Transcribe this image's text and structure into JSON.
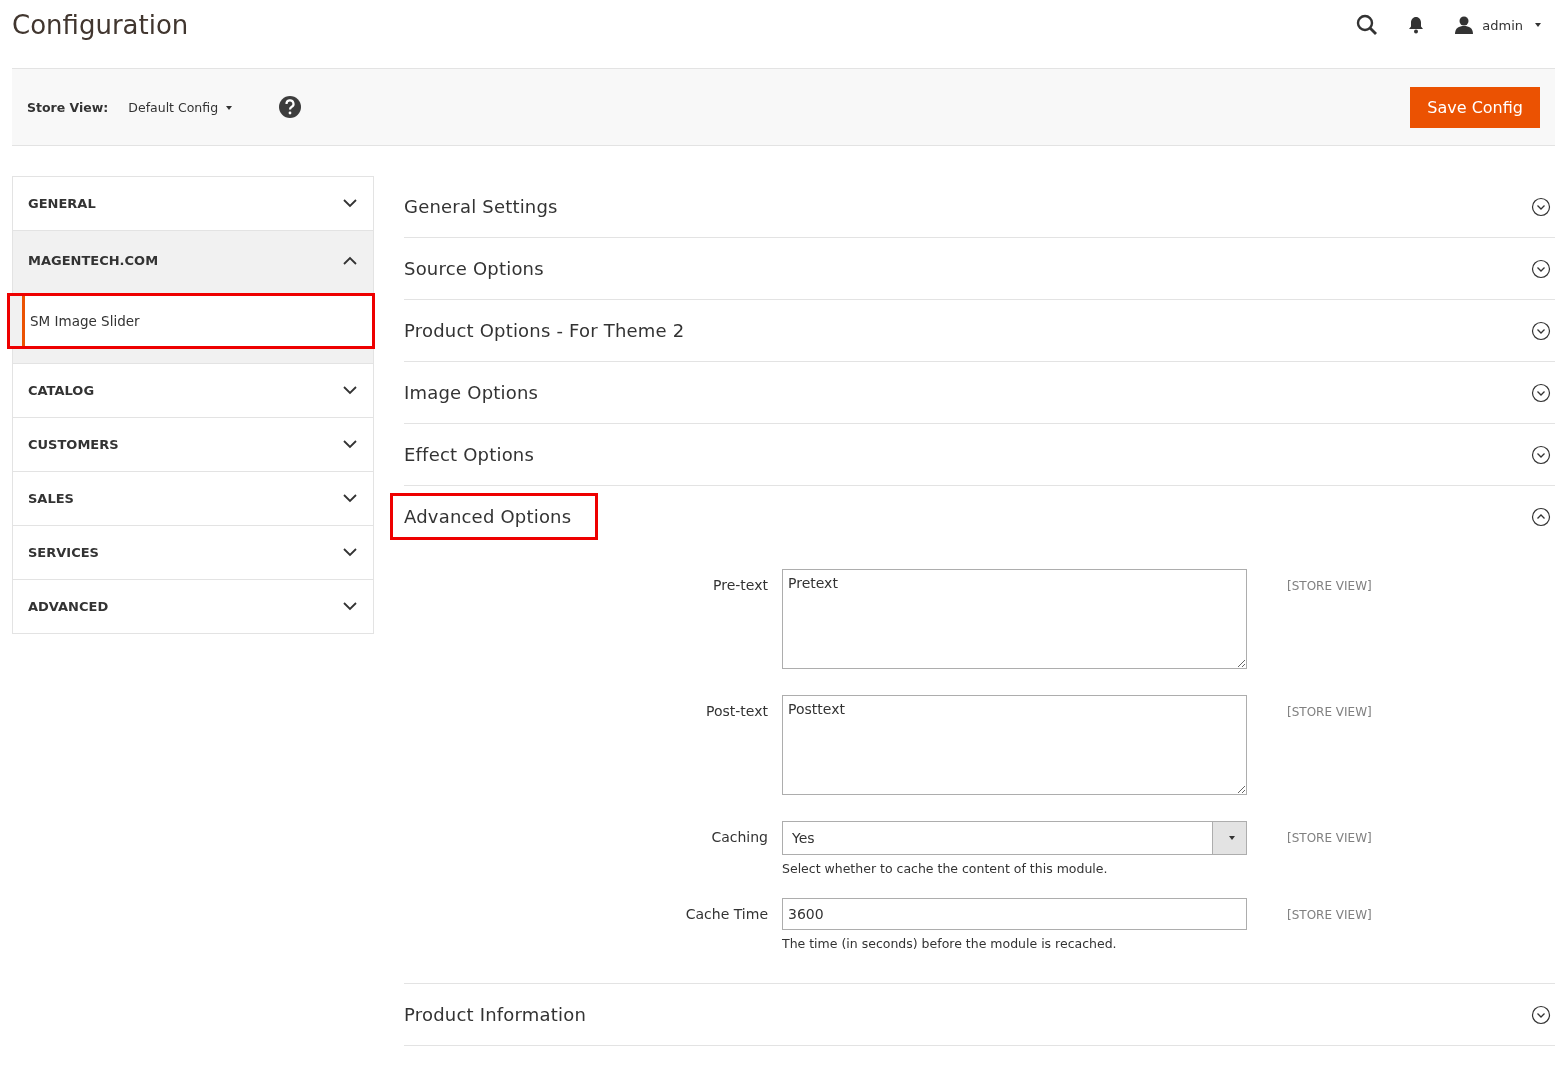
{
  "page_title": "Configuration",
  "header": {
    "user": "admin"
  },
  "store_view": {
    "label": "Store View:",
    "value": "Default Config"
  },
  "save_button": "Save Config",
  "sidebar": [
    {
      "label": "GENERAL",
      "expanded": false
    },
    {
      "label": "MAGENTECH.COM",
      "expanded": true,
      "children": [
        {
          "label": "SM Image Slider",
          "selected": true,
          "highlighted": true
        }
      ]
    },
    {
      "label": "CATALOG",
      "expanded": false
    },
    {
      "label": "CUSTOMERS",
      "expanded": false
    },
    {
      "label": "SALES",
      "expanded": false
    },
    {
      "label": "SERVICES",
      "expanded": false
    },
    {
      "label": "ADVANCED",
      "expanded": false
    }
  ],
  "sections": [
    {
      "title": "General Settings",
      "expanded": false,
      "highlighted": false
    },
    {
      "title": "Source Options",
      "expanded": false,
      "highlighted": false
    },
    {
      "title": "Product Options - For Theme 2",
      "expanded": false,
      "highlighted": false
    },
    {
      "title": "Image Options",
      "expanded": false,
      "highlighted": false
    },
    {
      "title": "Effect Options",
      "expanded": false,
      "highlighted": false
    },
    {
      "title": "Advanced Options",
      "expanded": true,
      "highlighted": true,
      "fields": [
        {
          "kind": "textarea",
          "label": "Pre-text",
          "value": "Pretext",
          "scope": "[STORE VIEW]"
        },
        {
          "kind": "textarea",
          "label": "Post-text",
          "value": "Posttext",
          "scope": "[STORE VIEW]"
        },
        {
          "kind": "select",
          "label": "Caching",
          "value": "Yes",
          "scope": "[STORE VIEW]",
          "note": "Select whether to cache the content of this module."
        },
        {
          "kind": "text",
          "label": "Cache Time",
          "value": "3600",
          "scope": "[STORE VIEW]",
          "note": "The time (in seconds) before the module is recached."
        }
      ]
    },
    {
      "title": "Product Information",
      "expanded": false,
      "highlighted": false
    }
  ]
}
